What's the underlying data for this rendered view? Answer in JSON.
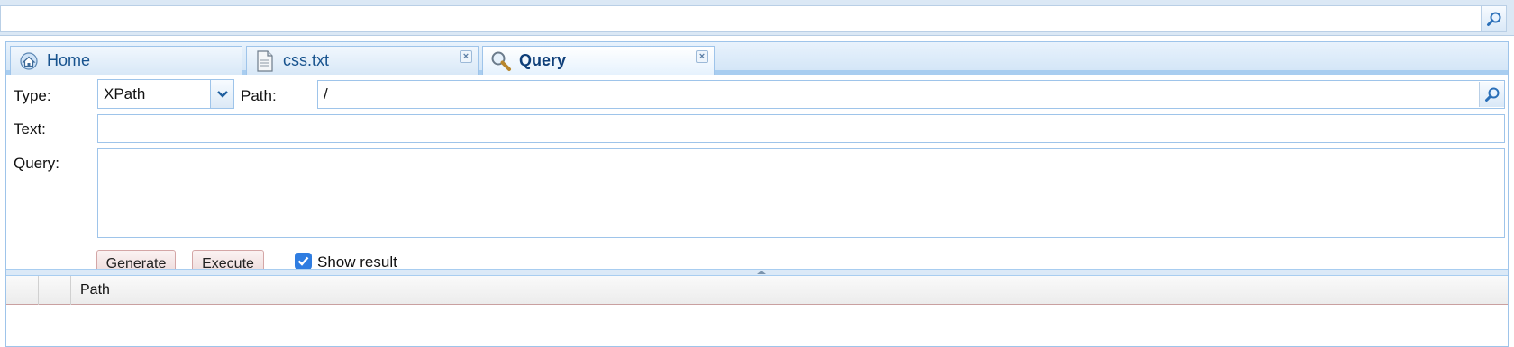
{
  "top_search": {
    "value": "",
    "placeholder": ""
  },
  "tabs": [
    {
      "label": "Home",
      "icon": "home-icon",
      "closable": false
    },
    {
      "label": "css.txt",
      "icon": "document-icon",
      "closable": true
    },
    {
      "label": "Query",
      "icon": "magnifier-icon",
      "closable": true,
      "active": true
    }
  ],
  "form": {
    "type_label": "Type:",
    "type_value": "XPath",
    "path_label": "Path:",
    "path_value": "/",
    "text_label": "Text:",
    "text_value": "",
    "query_label": "Query:",
    "query_value": ""
  },
  "actions": {
    "generate_label": "Generate",
    "execute_label": "Execute",
    "show_result_label": "Show result",
    "show_result_checked": true
  },
  "results_grid": {
    "columns": [
      "",
      "",
      "Path",
      ""
    ]
  },
  "colors": {
    "accent": "#2f7de1",
    "tab_text": "#18538e",
    "border": "#9ec4ea"
  }
}
